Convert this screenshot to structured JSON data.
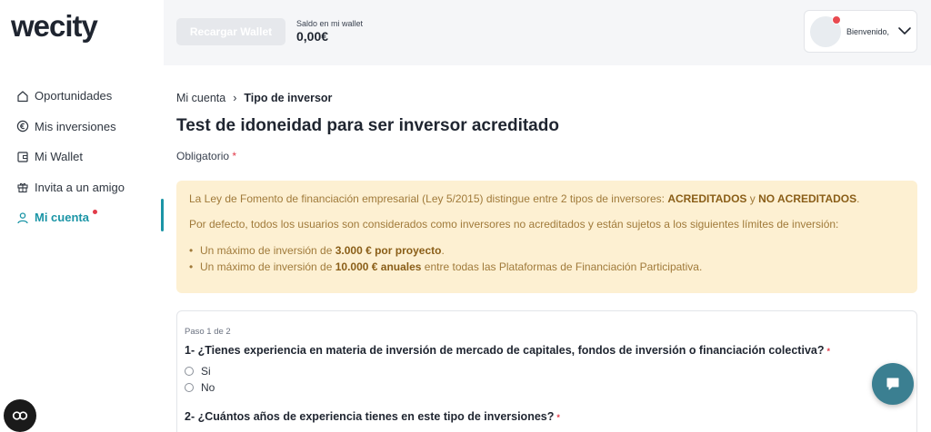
{
  "app": {
    "logo": "wecity"
  },
  "sidebar": {
    "items": [
      {
        "label": "Oportunidades",
        "icon": "house-icon"
      },
      {
        "label": "Mis inversiones",
        "icon": "euro-coin-icon"
      },
      {
        "label": "Mi Wallet",
        "icon": "wallet-icon"
      },
      {
        "label": "Invita a un amigo",
        "icon": "gift-icon"
      },
      {
        "label": "Mi cuenta",
        "icon": "user-icon",
        "active": true,
        "notification": true
      }
    ]
  },
  "header": {
    "recharge_label": "Recargar Wallet",
    "wallet_label": "Saldo en mi wallet",
    "wallet_value": "0,00€",
    "welcome": "Bienvenido,"
  },
  "breadcrumb": {
    "parent": "Mi cuenta",
    "separator": "›",
    "current": "Tipo de inversor"
  },
  "page": {
    "title": "Test de idoneidad para ser inversor acreditado",
    "required_label": "Obligatorio",
    "required_star": "*"
  },
  "notice": {
    "p1_text": "La Ley de Fomento de financiación empresarial (Ley 5/2015) distingue entre 2 tipos de inversores: ",
    "p1_bold1": "ACREDITADOS",
    "p1_mid": " y ",
    "p1_bold2": "NO ACREDITADOS",
    "p1_end": ".",
    "p2_text": "Por defecto, todos los usuarios son considerados como inversores no acreditados y están sujetos a los siguientes límites de inversión:",
    "bullet1_pre": "Un máximo de inversión de ",
    "bullet1_bold": "3.000 € por proyecto",
    "bullet1_post": ".",
    "bullet2_pre": "Un máximo de inversión de ",
    "bullet2_bold": "10.000 € anuales",
    "bullet2_post": " entre todas las Plataformas de Financiación Participativa."
  },
  "form": {
    "step_label": "Paso 1 de 2",
    "q1": "1- ¿Tienes experiencia en materia de inversión de mercado de capitales, fondos de inversión o financiación colectiva?",
    "q1_options": [
      "Si",
      "No"
    ],
    "q2": "2- ¿Cuántos años de experiencia tienes en este tipo de inversiones?",
    "required_star": "*"
  },
  "colors": {
    "accent": "#1b95a6",
    "notice_bg": "#fdf0d2",
    "notice_text": "#a07a3a",
    "alert_red": "#e23b4a",
    "chat_button": "#3b7f91"
  }
}
